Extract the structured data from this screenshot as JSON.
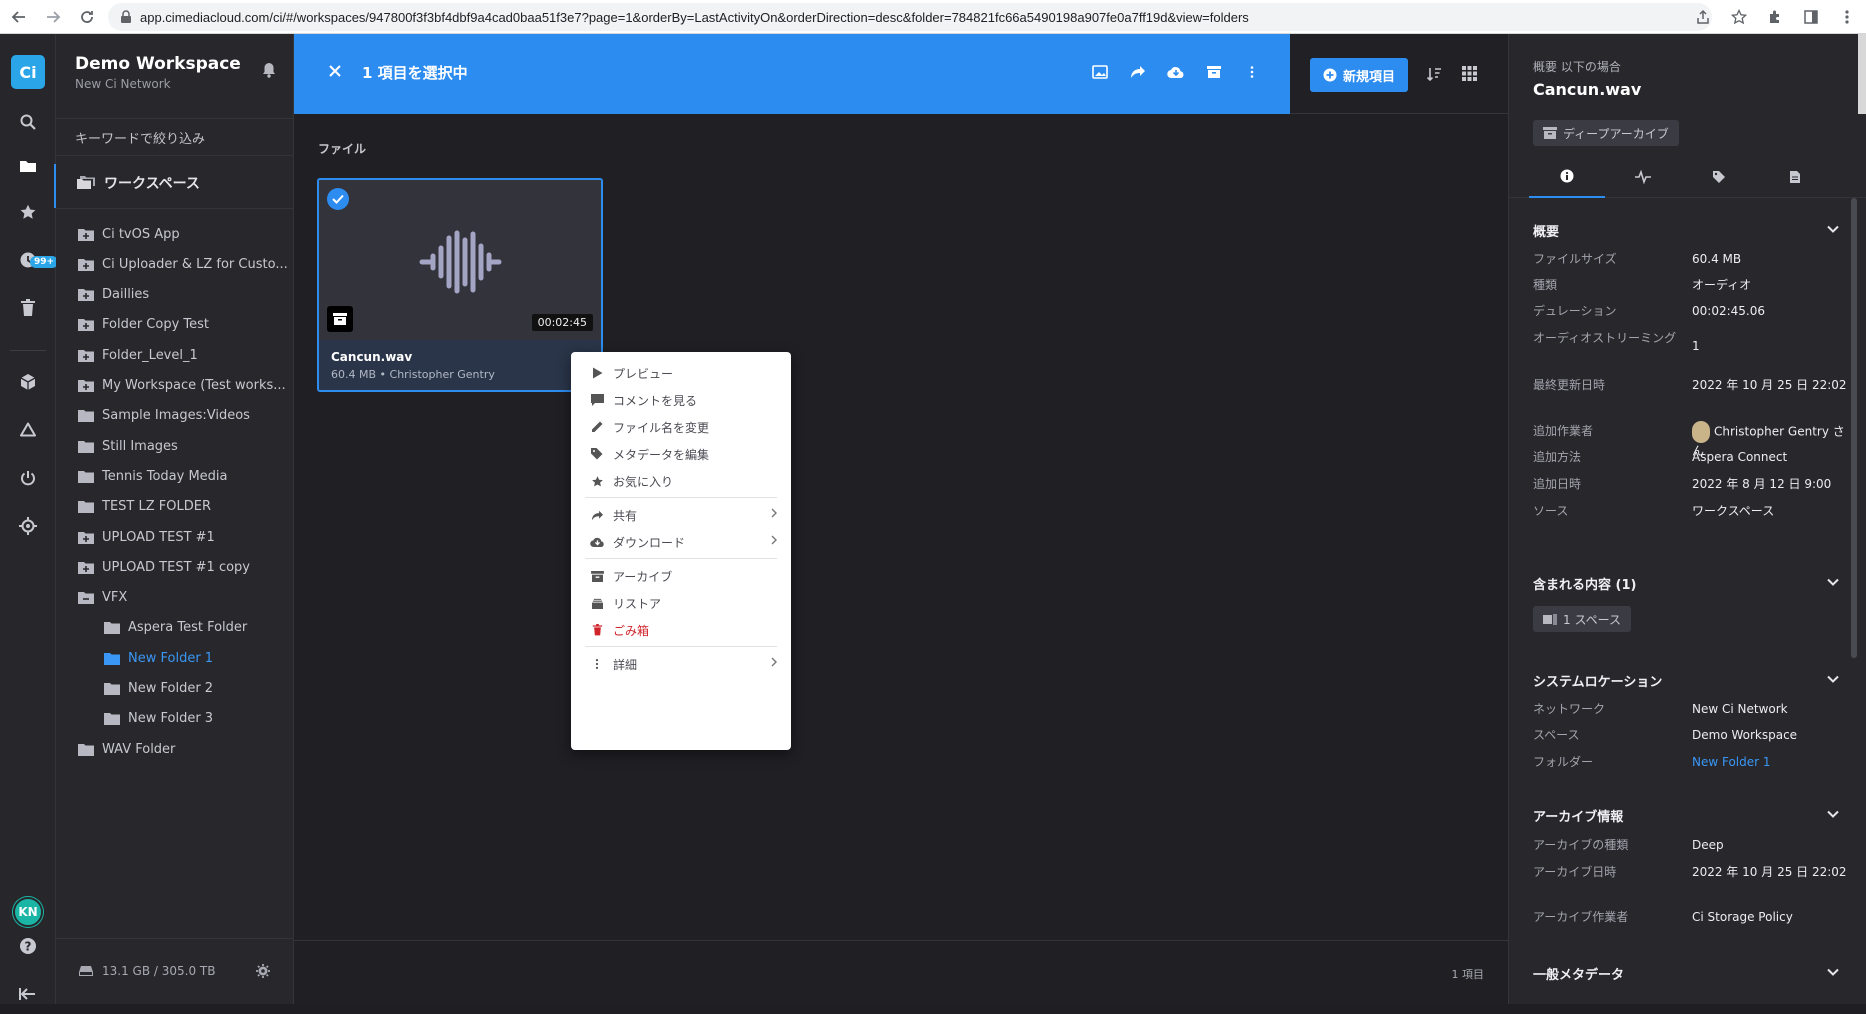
{
  "browser": {
    "url": "app.cimediacloud.com/ci/#/workspaces/947800f3f3bf4dbf9a4cad0baa51f3e7?page=1&orderBy=LastActivityOn&orderDirection=desc&folder=784821fc66a5490198a907fe0a7ff19d&view=folders"
  },
  "rail": {
    "logo": "Ci",
    "badge": "99+",
    "avatar": "KN"
  },
  "sidebar": {
    "workspace_title": "Demo Workspace",
    "workspace_sub": "New Ci Network",
    "filter_placeholder": "キーワードで絞り込み",
    "root_label": "ワークスペース",
    "items": [
      {
        "label": "Ci tvOS App",
        "level": 1,
        "icon": "folder-plus-icon"
      },
      {
        "label": "Ci Uploader & LZ for Custo...",
        "level": 1,
        "icon": "folder-plus-icon"
      },
      {
        "label": "Daillies",
        "level": 1,
        "icon": "folder-plus-icon"
      },
      {
        "label": "Folder Copy Test",
        "level": 1,
        "icon": "folder-plus-icon"
      },
      {
        "label": "Folder_Level_1",
        "level": 1,
        "icon": "folder-plus-icon"
      },
      {
        "label": "My Workspace (Test works...",
        "level": 1,
        "icon": "folder-plus-icon"
      },
      {
        "label": "Sample Images:Videos",
        "level": 1,
        "icon": "folder-icon"
      },
      {
        "label": "Still Images",
        "level": 1,
        "icon": "folder-icon"
      },
      {
        "label": "Tennis Today Media",
        "level": 1,
        "icon": "folder-icon"
      },
      {
        "label": "TEST LZ FOLDER",
        "level": 1,
        "icon": "folder-icon"
      },
      {
        "label": "UPLOAD TEST #1",
        "level": 1,
        "icon": "folder-plus-icon"
      },
      {
        "label": "UPLOAD TEST #1 copy",
        "level": 1,
        "icon": "folder-plus-icon"
      },
      {
        "label": "VFX",
        "level": 1,
        "icon": "folder-minus-icon"
      },
      {
        "label": "Aspera Test Folder",
        "level": 2,
        "icon": "folder-icon"
      },
      {
        "label": "New Folder 1",
        "level": 2,
        "icon": "folder-icon",
        "active": true
      },
      {
        "label": "New Folder 2",
        "level": 2,
        "icon": "folder-icon"
      },
      {
        "label": "New Folder 3",
        "level": 2,
        "icon": "folder-icon"
      },
      {
        "label": "WAV Folder",
        "level": 1,
        "icon": "folder-icon"
      }
    ],
    "storage": "13.1 GB / 305.0 TB"
  },
  "selection_bar": {
    "text": "1 項目を選択中"
  },
  "toolbar": {
    "new_item_label": "新規項目"
  },
  "main": {
    "section_label": "ファイル",
    "item_count": "1 項目",
    "file": {
      "name": "Cancun.wav",
      "sub": "60.4 MB • Christopher Gentry",
      "duration": "00:02:45"
    }
  },
  "context_menu": {
    "items": [
      {
        "label": "プレビュー",
        "icon": "play-icon"
      },
      {
        "label": "コメントを見る",
        "icon": "comment-icon"
      },
      {
        "label": "ファイル名を変更",
        "icon": "pencil-icon"
      },
      {
        "label": "メタデータを編集",
        "icon": "tag-icon"
      },
      {
        "label": "お気に入り",
        "icon": "star-icon"
      },
      {
        "label": "共有",
        "icon": "share-icon",
        "submenu": true
      },
      {
        "label": "ダウンロード",
        "icon": "cloud-download-icon",
        "submenu": true
      },
      {
        "label": "アーカイブ",
        "icon": "archive-icon"
      },
      {
        "label": "リストア",
        "icon": "restore-icon"
      },
      {
        "label": "ごみ箱",
        "icon": "trash-icon",
        "danger": true
      },
      {
        "label": "詳細",
        "icon": "more-vertical-icon",
        "submenu": true
      }
    ]
  },
  "details": {
    "crumb": "概要 以下の場合",
    "title": "Cancun.wav",
    "archive_pill": "ディープアーカイブ",
    "overview": {
      "heading": "概要",
      "rows": [
        {
          "label": "ファイルサイズ",
          "value": "60.4 MB"
        },
        {
          "label": "種類",
          "value": "オーディオ"
        },
        {
          "label": "デュレーション",
          "value": "00:02:45.06"
        },
        {
          "label": "オーディオストリーミング",
          "value": "1"
        },
        {
          "label": "最終更新日時",
          "value": "2022 年 10 月 25 日 22:02"
        },
        {
          "label": "追加作業者",
          "value": "Christopher Gentry さん"
        },
        {
          "label": "追加方法",
          "value": "Aspera Connect"
        },
        {
          "label": "追加日時",
          "value": "2022 年 8 月 12 日 9:00"
        },
        {
          "label": "ソース",
          "value": "ワークスペース"
        }
      ]
    },
    "contents": {
      "heading": "含まれる内容 (1)",
      "pill": "1 スペース"
    },
    "location": {
      "heading": "システムロケーション",
      "rows": [
        {
          "label": "ネットワーク",
          "value": "New Ci Network"
        },
        {
          "label": "スペース",
          "value": "Demo Workspace"
        },
        {
          "label": "フォルダー",
          "value": "New Folder 1"
        }
      ]
    },
    "archive": {
      "heading": "アーカイブ情報",
      "rows": [
        {
          "label": "アーカイブの種類",
          "value": "Deep"
        },
        {
          "label": "アーカイブ日時",
          "value": "2022 年 10 月 25 日 22:02"
        },
        {
          "label": "アーカイブ作業者",
          "value": "Ci Storage Policy"
        }
      ]
    },
    "general": {
      "heading": "一般メタデータ"
    }
  }
}
